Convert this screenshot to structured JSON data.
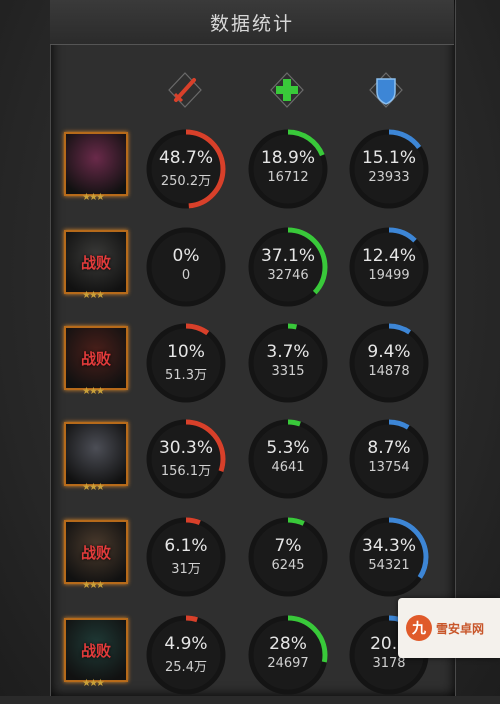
{
  "header": {
    "title": "数据统计"
  },
  "columns": [
    {
      "icon": "sword-attack-icon",
      "color": "#d8402a"
    },
    {
      "icon": "heal-cross-icon",
      "color": "#39c93a"
    },
    {
      "icon": "shield-icon",
      "color": "#3d86d6"
    }
  ],
  "rows": [
    {
      "status": "",
      "stats": [
        {
          "pct": "48.7%",
          "value": "250.2万",
          "fraction": 0.487
        },
        {
          "pct": "18.9%",
          "value": "16712",
          "fraction": 0.189
        },
        {
          "pct": "15.1%",
          "value": "23933",
          "fraction": 0.151
        }
      ]
    },
    {
      "status": "战败",
      "stats": [
        {
          "pct": "0%",
          "value": "0",
          "fraction": 0.0
        },
        {
          "pct": "37.1%",
          "value": "32746",
          "fraction": 0.371
        },
        {
          "pct": "12.4%",
          "value": "19499",
          "fraction": 0.124
        }
      ]
    },
    {
      "status": "战败",
      "stats": [
        {
          "pct": "10%",
          "value": "51.3万",
          "fraction": 0.1
        },
        {
          "pct": "3.7%",
          "value": "3315",
          "fraction": 0.037
        },
        {
          "pct": "9.4%",
          "value": "14878",
          "fraction": 0.094
        }
      ]
    },
    {
      "status": "",
      "stats": [
        {
          "pct": "30.3%",
          "value": "156.1万",
          "fraction": 0.303
        },
        {
          "pct": "5.3%",
          "value": "4641",
          "fraction": 0.053
        },
        {
          "pct": "8.7%",
          "value": "13754",
          "fraction": 0.087
        }
      ]
    },
    {
      "status": "战败",
      "stats": [
        {
          "pct": "6.1%",
          "value": "31万",
          "fraction": 0.061
        },
        {
          "pct": "7%",
          "value": "6245",
          "fraction": 0.07
        },
        {
          "pct": "34.3%",
          "value": "54321",
          "fraction": 0.343
        }
      ]
    },
    {
      "status": "战败",
      "stats": [
        {
          "pct": "4.9%",
          "value": "25.4万",
          "fraction": 0.049
        },
        {
          "pct": "28%",
          "value": "24697",
          "fraction": 0.28
        },
        {
          "pct": "20.1",
          "value": "3178",
          "fraction": 0.201
        }
      ]
    }
  ],
  "portrait_colors": [
    "#6a2a4a",
    "#3a3a38",
    "#4a1f1a",
    "#4c4e56",
    "#4a3a2c",
    "#1f3a36"
  ],
  "stars_glyph": "★★★",
  "watermark": {
    "logo": "九",
    "text": "雪安卓网"
  }
}
